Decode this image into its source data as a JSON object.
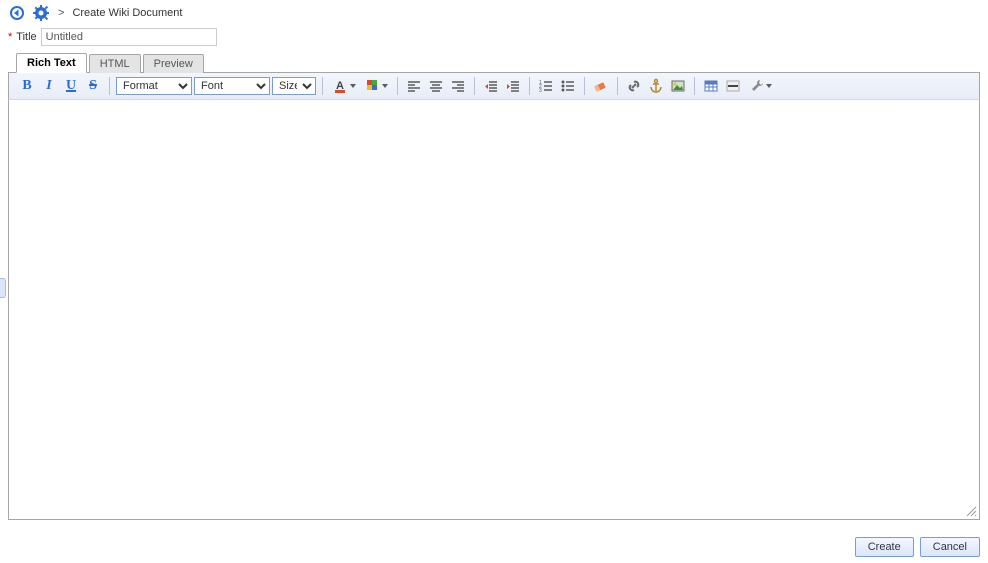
{
  "header": {
    "breadcrumb_sep": ">",
    "breadcrumb_text": "Create Wiki Document"
  },
  "title_field": {
    "required_mark": "*",
    "label": "Title",
    "value": "Untitled"
  },
  "tabs": {
    "rich_text": "Rich Text",
    "html": "HTML",
    "preview": "Preview"
  },
  "toolbar": {
    "format_label": "Format",
    "font_label": "Font",
    "size_label": "Size"
  },
  "footer": {
    "create": "Create",
    "cancel": "Cancel"
  }
}
